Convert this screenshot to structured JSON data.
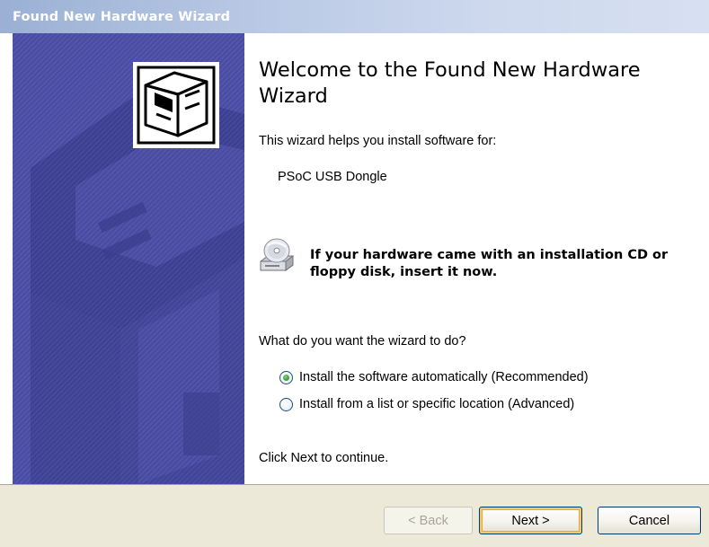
{
  "window": {
    "title": "Found New Hardware Wizard"
  },
  "main": {
    "heading": "Welcome to the Found New Hardware Wizard",
    "intro": "This wizard helps you install software for:",
    "device_name": "PSoC USB Dongle",
    "cd_message": "If your hardware came with an installation CD or floppy disk, insert it now.",
    "question": "What do you want the wizard to do?",
    "options": [
      {
        "label": "Install the software automatically (Recommended)",
        "selected": true
      },
      {
        "label": "Install from a list or specific location (Advanced)",
        "selected": false
      }
    ],
    "continue_hint": "Click Next to continue."
  },
  "buttons": {
    "back_label": "< Back",
    "back_enabled": false,
    "next_label": "Next >",
    "cancel_label": "Cancel"
  },
  "icons": {
    "banner": "hardware-box-icon",
    "cd": "cd-drive-icon"
  },
  "colors": {
    "side_panel": "#4b4da3",
    "titlebar": "#9ab0d4",
    "footer": "#ece9d8",
    "radio_selected": "#2f9e2a"
  }
}
